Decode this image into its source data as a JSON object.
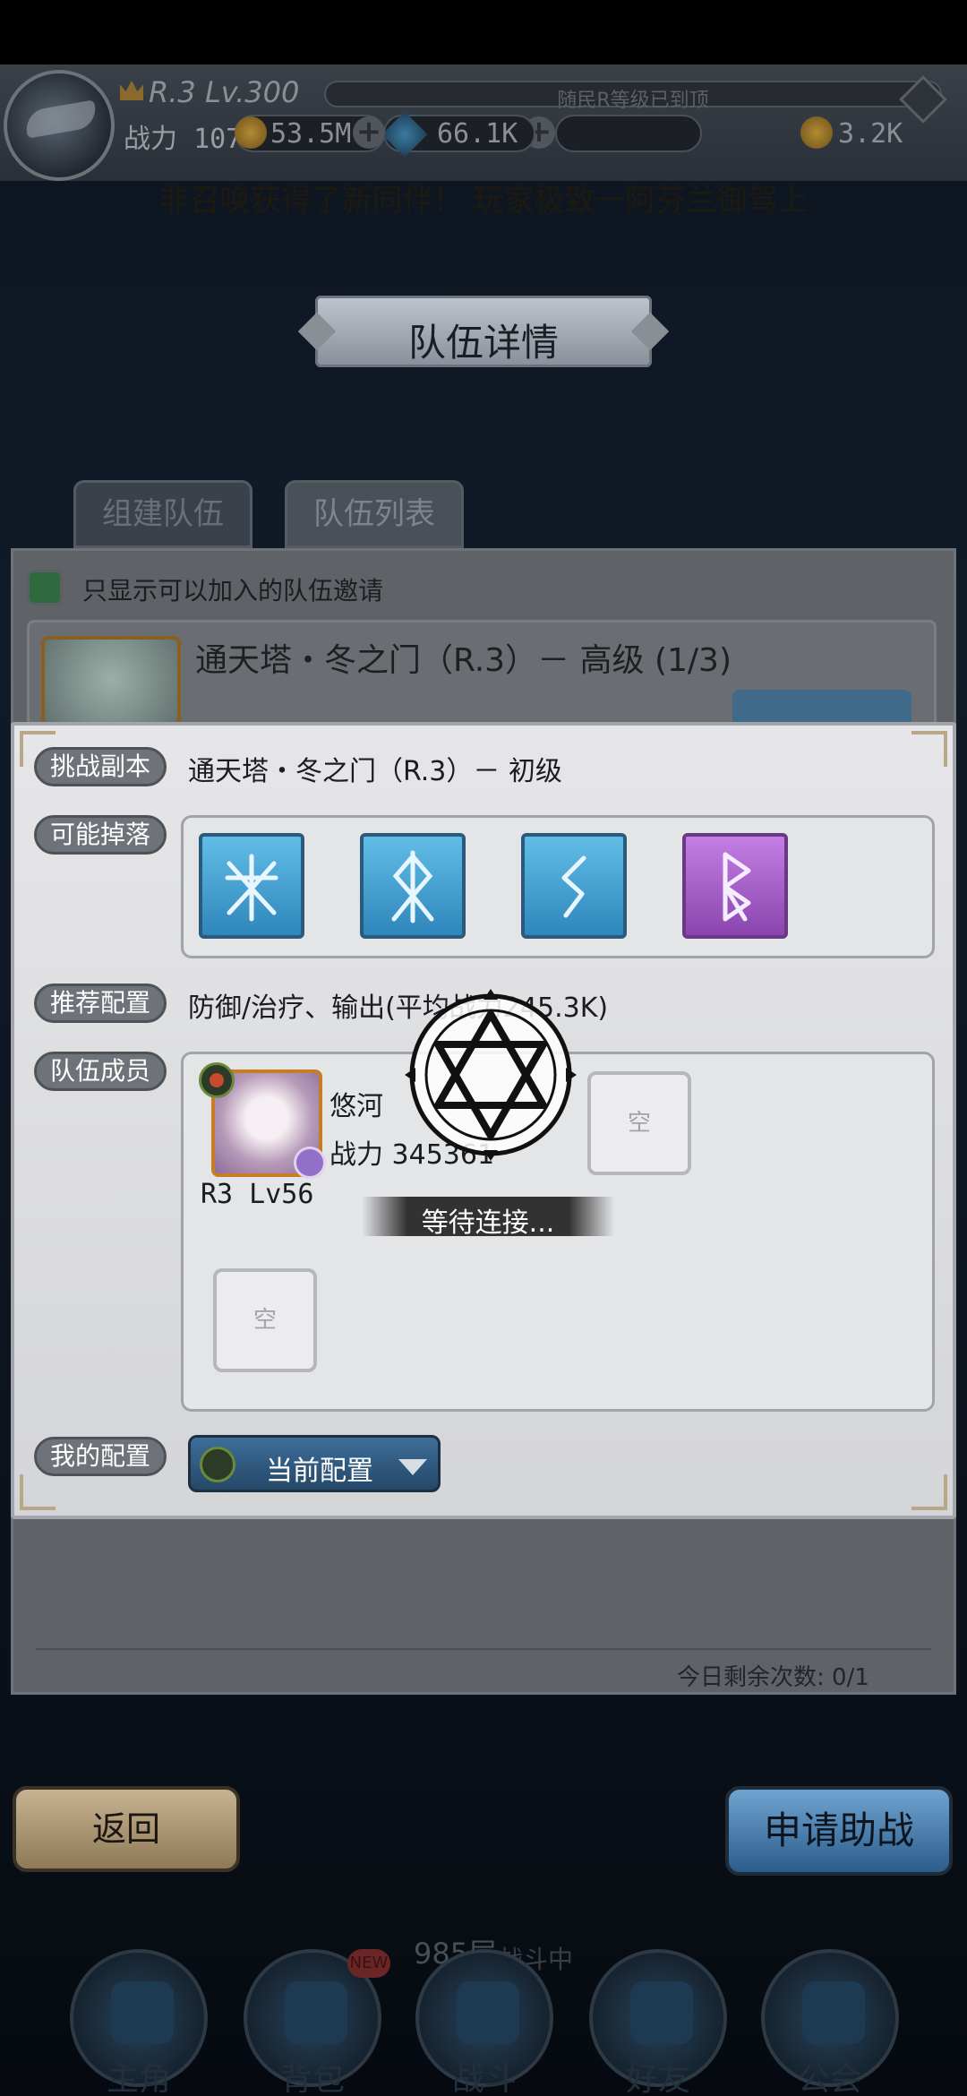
{
  "hud": {
    "rank": "R.3 Lv.300",
    "exp_text": "随民R等级已到顶",
    "power_label": "战力",
    "power_value": "1076906",
    "gold": "53.5M",
    "gems": "66.1K",
    "coins": "3.2K",
    "ticker": "非召唤获得了新同伴！ 玩家极致一阿芬兰御驾上"
  },
  "title": "队伍详情",
  "tabs": [
    "组建队伍",
    "队伍列表"
  ],
  "list": {
    "checkbox_label": "只显示可以加入的队伍邀请",
    "row_title": "通天塔・冬之门（R.3）－ 高级 (1/3)",
    "remaining": "今日剩余次数: 0/1"
  },
  "modal": {
    "challenge_tag": "挑战副本",
    "challenge_value": "通天塔・冬之门（R.3）－ 初级",
    "drops_tag": "可能掉落",
    "recommend_tag": "推荐配置",
    "recommend_value": "防御/治疗、输出(平均战力245.3K)",
    "members_tag": "队伍成员",
    "member": {
      "name": "悠河",
      "power": "战力 345361",
      "level": "R3 Lv56"
    },
    "empty_label": "空",
    "my_config_tag": "我的配置",
    "config_value": "当前配置"
  },
  "loading": {
    "text": "等待连接..."
  },
  "buttons": {
    "back": "返回",
    "apply": "申请助战"
  },
  "bottom": {
    "floor": "985层",
    "status": "战斗中",
    "new_badge": "NEW",
    "nav": [
      "主角",
      "背包",
      "战斗",
      "好友",
      "公会"
    ]
  },
  "colors": {
    "rune_blue": "#3f9fd4",
    "rune_purple": "#a85fcc",
    "tag_gray": "#6e7379",
    "apply_blue": "#2c5d8a"
  }
}
